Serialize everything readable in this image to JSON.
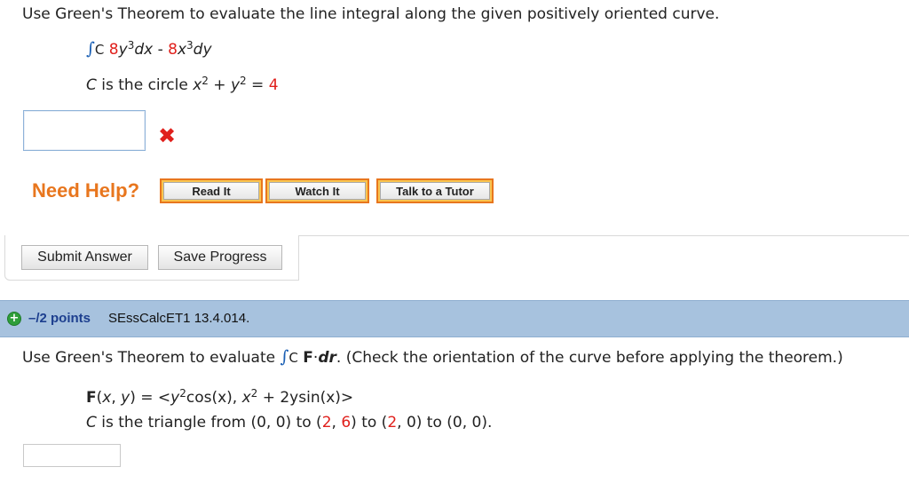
{
  "q1": {
    "instruction": "Use Green's Theorem to evaluate the line integral along the given positively oriented curve.",
    "integral_symbol": "∫",
    "integral_sub": "C",
    "coef1": "8",
    "var1": "y",
    "exp1": "3",
    "d1": "dx",
    "minus": " - ",
    "coef2": "8",
    "var2": "x",
    "exp2": "3",
    "d2": "dy",
    "curve_prefix": "C",
    "curve_text": " is the circle ",
    "x": "x",
    "exp_x": "2",
    "plus": " + ",
    "y": "y",
    "exp_y": "2",
    "eq": " = ",
    "rhs": "4",
    "answer_value": "",
    "status_icon": "x-mark-icon"
  },
  "help": {
    "label": "Need Help?",
    "read_it": "Read It",
    "watch_it": "Watch It",
    "talk_to_tutor": "Talk to a Tutor"
  },
  "actions": {
    "submit": "Submit Answer",
    "save": "Save Progress"
  },
  "q2": {
    "points": "–/2 points",
    "id": "SEssCalcET1 13.4.014.",
    "instruction_start": "Use Green's Theorem to evaluate ",
    "integral_symbol": "∫",
    "integral_sub": "C",
    "F": "F",
    "dot": "·",
    "dr": "dr",
    "instruction_end": ". (Check the orientation of the curve before applying the theorem.)",
    "func_lhs": "F",
    "func_args_open": "(",
    "fx": "x",
    "comma": ", ",
    "fy": "y",
    "func_args_close": ")",
    "func_eq": " = ",
    "vec_open": "<",
    "comp1_y": "y",
    "comp1_exp": "2",
    "comp1_rest": "cos(x), ",
    "comp2_x": "x",
    "comp2_exp": "2",
    "comp2_rest": " + 2ysin(x)",
    "vec_close": ">",
    "tri_prefix": "C",
    "tri_text1": " is the triangle from (0, 0) to (",
    "tri_a": "2",
    "tri_comma1": ", ",
    "tri_b": "6",
    "tri_text2": ") to (",
    "tri_c": "2",
    "tri_text3": ", 0) to (0, 0).",
    "answer_value": ""
  },
  "colors": {
    "accent_red": "#e0201c",
    "help_orange": "#e8761e",
    "header_blue": "#a7c2de",
    "points_blue": "#1d3f8f"
  }
}
